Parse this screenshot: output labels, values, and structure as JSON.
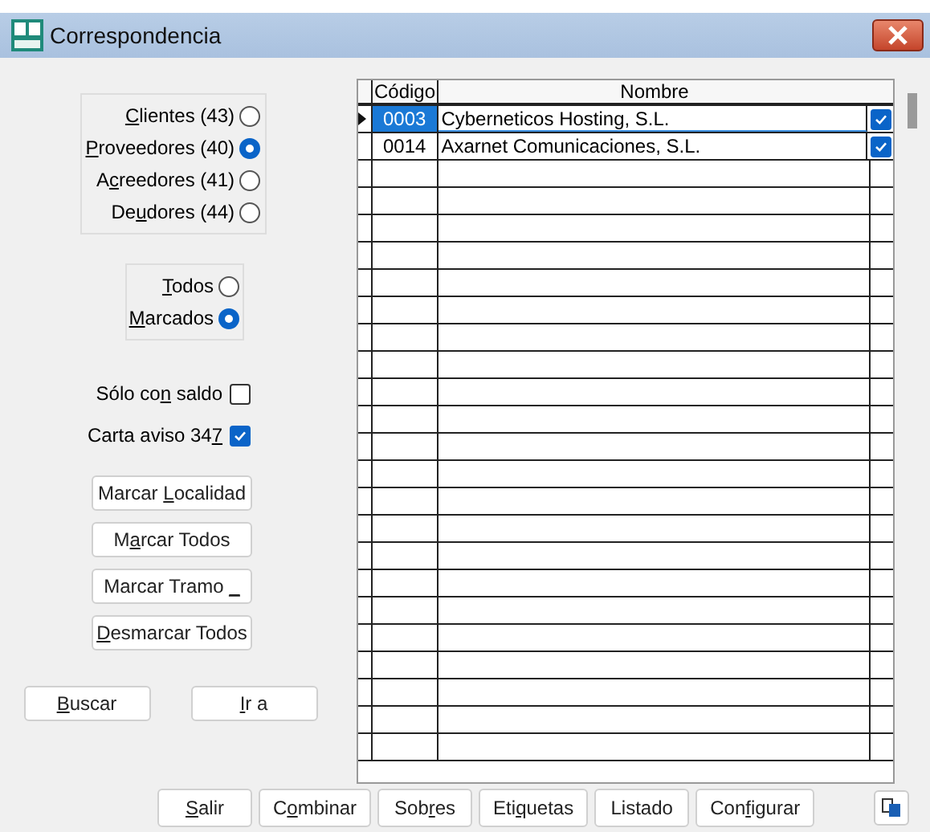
{
  "window": {
    "title": "Correspondencia"
  },
  "types": [
    {
      "key": "C",
      "post": "lientes (43)",
      "selected": false
    },
    {
      "key": "P",
      "post": "roveedores (40)",
      "selected": true
    },
    {
      "pre": "A",
      "key": "c",
      "post": "reedores (41)",
      "selected": false
    },
    {
      "pre": "De",
      "key": "u",
      "post": "dores (44)",
      "selected": false
    }
  ],
  "scope": [
    {
      "key": "T",
      "post": "odos",
      "selected": false
    },
    {
      "key": "M",
      "post": "arcados",
      "selected": true
    }
  ],
  "options": [
    {
      "pre": "Sólo co",
      "key": "n",
      "post": " saldo",
      "checked": false
    },
    {
      "pre": "Carta aviso 34",
      "key": "7",
      "checked": true
    }
  ],
  "mark_buttons": [
    {
      "pre": "Marcar ",
      "key": "L",
      "post": "ocalidad"
    },
    {
      "pre": "M",
      "key": "a",
      "post": "rcar Todos"
    },
    {
      "pre": "Marcar Tramo ",
      "key": "_"
    },
    {
      "key": "D",
      "post": "esmarcar Todos"
    }
  ],
  "nav_buttons": [
    {
      "key": "B",
      "post": "uscar"
    },
    {
      "key": "I",
      "post": "r a"
    }
  ],
  "table": {
    "columns": [
      "Código",
      "Nombre"
    ],
    "rows": [
      {
        "codigo": "0003",
        "nombre": "Cyberneticos Hosting, S.L.",
        "checked": true,
        "selected": true
      },
      {
        "codigo": "0014",
        "nombre": "Axarnet Comunicaciones, S.L.",
        "checked": true,
        "selected": false
      }
    ]
  },
  "footer_buttons": [
    {
      "key": "S",
      "post": "alir"
    },
    {
      "pre": "C",
      "key": "o",
      "post": "mbinar"
    },
    {
      "pre": "Sob",
      "key": "r",
      "post": "es"
    },
    {
      "pre": "Eti",
      "key": "q",
      "post": "uetas"
    },
    {
      "pre": "Listado"
    },
    {
      "pre": "Con",
      "key": "f",
      "post": "igurar"
    }
  ]
}
